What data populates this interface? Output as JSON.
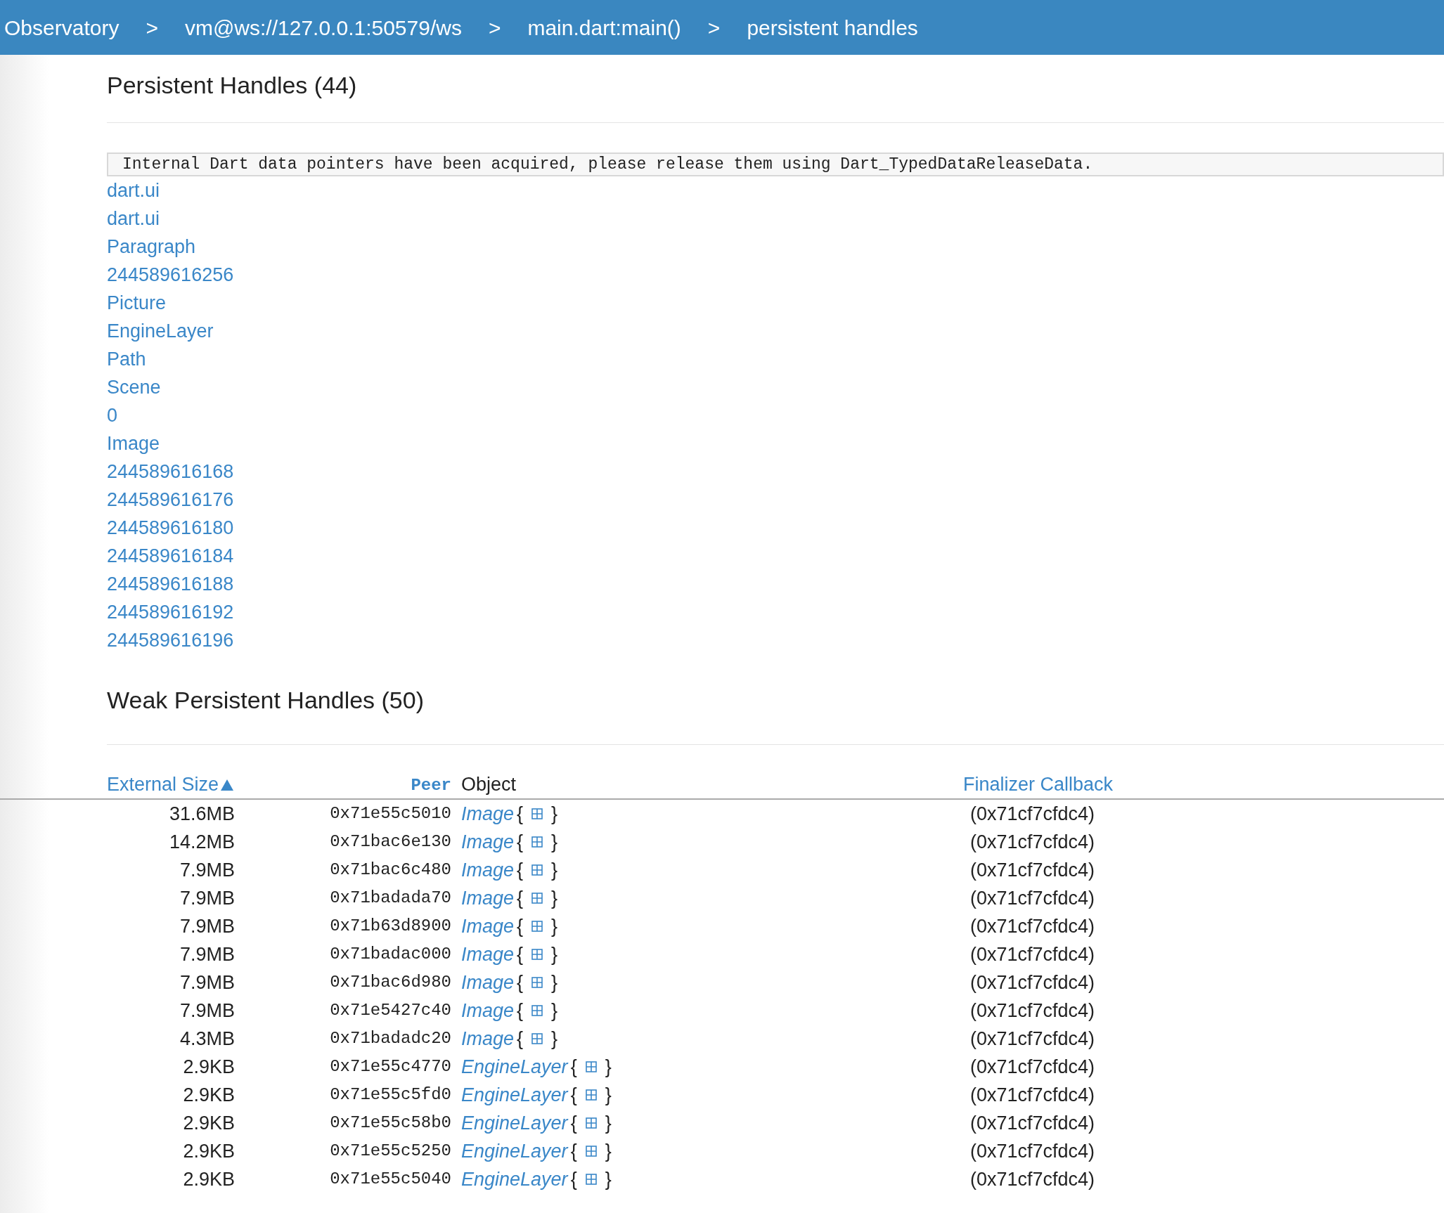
{
  "breadcrumbs": [
    {
      "label": "Observatory"
    },
    {
      "label": "vm@ws://127.0.0.1:50579/ws"
    },
    {
      "label": "main.dart:main()"
    },
    {
      "label": "persistent handles"
    }
  ],
  "separator": ">",
  "persistent": {
    "title": "Persistent Handles (44)",
    "message": "Internal Dart data pointers have been acquired, please release them using Dart_TypedDataReleaseData.",
    "items": [
      "dart.ui",
      "dart.ui",
      "Paragraph",
      "244589616256",
      "Picture",
      "EngineLayer",
      "Path",
      "Scene",
      "0",
      "Image",
      "244589616168",
      "244589616176",
      "244589616180",
      "244589616184",
      "244589616188",
      "244589616192",
      "244589616196"
    ]
  },
  "weak": {
    "title": "Weak Persistent Handles (50)",
    "columns": [
      {
        "label": "External Size",
        "sorted": true
      },
      {
        "label": "Peer",
        "sorted": false
      },
      {
        "label": "Object",
        "sorted": false
      },
      {
        "label": "Finalizer Callback",
        "sorted": false
      }
    ],
    "rows": [
      {
        "size": "31.6MB",
        "peer": "0x71e55c5010",
        "object": "Image",
        "open": "{",
        "close": "}",
        "callback": "(0x71cf7cfdc4)"
      },
      {
        "size": "14.2MB",
        "peer": "0x71bac6e130",
        "object": "Image",
        "open": "{",
        "close": "}",
        "callback": "(0x71cf7cfdc4)"
      },
      {
        "size": "7.9MB",
        "peer": "0x71bac6c480",
        "object": "Image",
        "open": "{",
        "close": "}",
        "callback": "(0x71cf7cfdc4)"
      },
      {
        "size": "7.9MB",
        "peer": "0x71badada70",
        "object": "Image",
        "open": "{",
        "close": "}",
        "callback": "(0x71cf7cfdc4)"
      },
      {
        "size": "7.9MB",
        "peer": "0x71b63d8900",
        "object": "Image",
        "open": "{",
        "close": "}",
        "callback": "(0x71cf7cfdc4)"
      },
      {
        "size": "7.9MB",
        "peer": "0x71badac000",
        "object": "Image",
        "open": "{",
        "close": "}",
        "callback": "(0x71cf7cfdc4)"
      },
      {
        "size": "7.9MB",
        "peer": "0x71bac6d980",
        "object": "Image",
        "open": "{",
        "close": "}",
        "callback": "(0x71cf7cfdc4)"
      },
      {
        "size": "7.9MB",
        "peer": "0x71e5427c40",
        "object": "Image",
        "open": "{",
        "close": "}",
        "callback": "(0x71cf7cfdc4)"
      },
      {
        "size": "4.3MB",
        "peer": "0x71badadc20",
        "object": "Image",
        "open": "{",
        "close": "}",
        "callback": "(0x71cf7cfdc4)"
      },
      {
        "size": "2.9KB",
        "peer": "0x71e55c4770",
        "object": "EngineLayer",
        "open": "{",
        "close": "}",
        "callback": "(0x71cf7cfdc4)"
      },
      {
        "size": "2.9KB",
        "peer": "0x71e55c5fd0",
        "object": "EngineLayer",
        "open": "{",
        "close": "}",
        "callback": "(0x71cf7cfdc4)"
      },
      {
        "size": "2.9KB",
        "peer": "0x71e55c58b0",
        "object": "EngineLayer",
        "open": "{",
        "close": "}",
        "callback": "(0x71cf7cfdc4)"
      },
      {
        "size": "2.9KB",
        "peer": "0x71e55c5250",
        "object": "EngineLayer",
        "open": "{",
        "close": "}",
        "callback": "(0x71cf7cfdc4)"
      },
      {
        "size": "2.9KB",
        "peer": "0x71e55c5040",
        "object": "EngineLayer",
        "open": "{",
        "close": "}",
        "callback": "(0x71cf7cfdc4)"
      }
    ]
  }
}
